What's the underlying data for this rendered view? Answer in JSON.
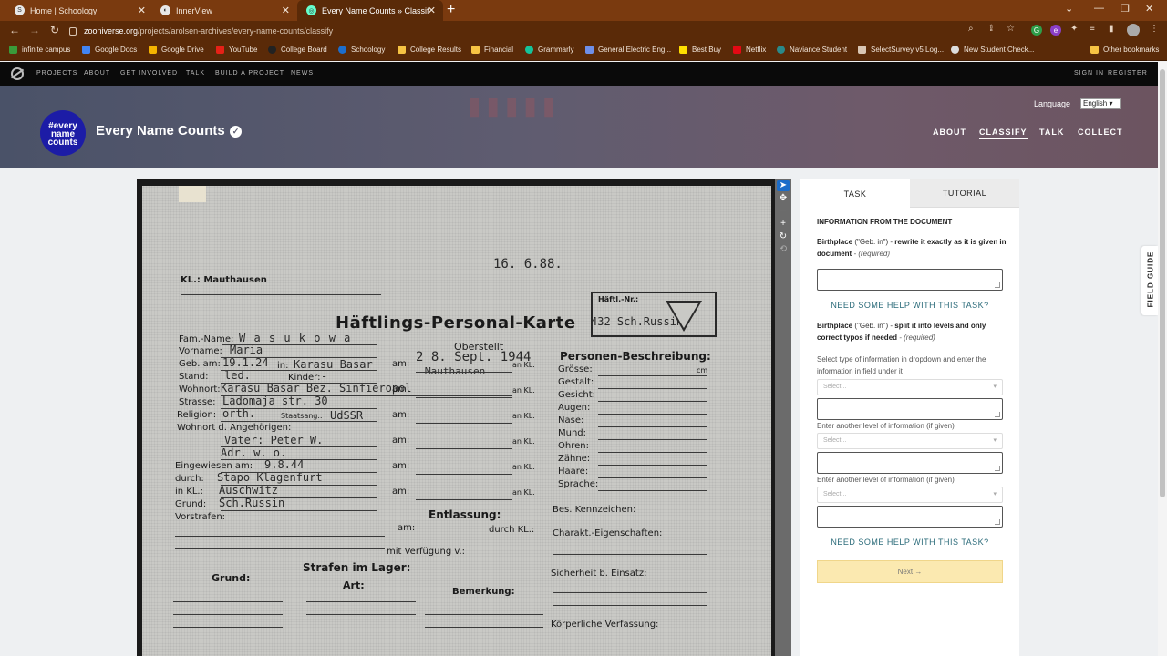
{
  "browser": {
    "tabs": [
      {
        "label": "Home | Schoology",
        "icon": "schoology-icon"
      },
      {
        "label": "InnerView",
        "icon": "innerview-icon"
      },
      {
        "label": "Every Name Counts » Classify —",
        "icon": "zooniverse-icon"
      }
    ],
    "url_host": "zooniverse.org",
    "url_path": "/projects/arolsen-archives/every-name-counts/classify",
    "bookmarks": [
      "infinite campus",
      "Google Docs",
      "Google Drive",
      "YouTube",
      "College Board",
      "Schoology",
      "College Results",
      "Financial",
      "Grammarly",
      "General Electric Eng...",
      "Best Buy",
      "Netflix",
      "Naviance Student",
      "SelectSurvey v5 Log...",
      "New Student Check..."
    ],
    "other_bookmarks": "Other bookmarks"
  },
  "site_nav": {
    "links": [
      "PROJECTS",
      "ABOUT",
      "GET INVOLVED",
      "TALK",
      "BUILD A PROJECT",
      "NEWS"
    ],
    "sign_in": "SIGN IN",
    "register": "REGISTER"
  },
  "project": {
    "logo_text": "#every name counts",
    "title": "Every Name Counts",
    "language_label": "Language",
    "language_value": "English",
    "nav": [
      "ABOUT",
      "CLASSIFY",
      "TALK",
      "COLLECT"
    ]
  },
  "document": {
    "camp": "KL.: Mauthausen",
    "date": "16. 6.88.",
    "haftl_label": "Häftl.-Nr.:",
    "haftl_value": "432 Sch.Russin",
    "heading": "Häftlings-Personal-Karte",
    "fields": [
      {
        "label": "Fam.-Name:",
        "value": "W a s u k o w a"
      },
      {
        "label": "Vorname:",
        "value": "Maria"
      },
      {
        "label": "Geb. am:",
        "value": "19.1.24"
      },
      {
        "label": "in:",
        "value": "Karasu Basar"
      },
      {
        "label": "Stand:",
        "value": "led."
      },
      {
        "label": "Kinder:",
        "value": "-"
      },
      {
        "label": "Wohnort:",
        "value": "Karasu Basar Bez. Sinfieropol"
      },
      {
        "label": "Strasse:",
        "value": "Ladomaja str. 30"
      },
      {
        "label": "Religion:",
        "value": "orth."
      },
      {
        "label": "Staatsang.:",
        "value": "UdSSR"
      },
      {
        "label": "Wohnort d. Angehörigen:",
        "value": "Vater: Peter W."
      },
      {
        "label": "",
        "value": "Adr. w. o."
      },
      {
        "label": "Eingewiesen am:",
        "value": "9.8.44"
      },
      {
        "label": "durch:",
        "value": "Stapo Klagenfurt"
      },
      {
        "label": "in KL.:",
        "value": "Auschwitz"
      },
      {
        "label": "Grund:",
        "value": "Sch.Russin"
      },
      {
        "label": "Vorstrafen:",
        "value": ""
      }
    ],
    "overstellt_date": "2 8. Sept. 1944",
    "overstellt_label": "Oberstellt",
    "overstellt_camp": "Mauthausen",
    "am_labels": [
      "am:",
      "am:",
      "am:",
      "am:",
      "am:",
      "am:",
      "am:",
      "am:"
    ],
    "an_kl": "an KL.",
    "personen": "Personen-Beschreibung:",
    "personen_fields": [
      "Grösse:",
      "Gestalt:",
      "Gesicht:",
      "Augen:",
      "Nase:",
      "Mund:",
      "Ohren:",
      "Zähne:",
      "Haare:",
      "Sprache:"
    ],
    "cm": "cm",
    "bes": "Bes. Kennzeichen:",
    "charakt": "Charakt.-Eigenschaften:",
    "entlassung": "Entlassung:",
    "durch_kl": "durch KL.:",
    "verfuegung": "mit Verfügung v.:",
    "strafen": "Strafen im Lager:",
    "grund": "Grund:",
    "art": "Art:",
    "bemerkung": "Bemerkung:",
    "sicherheit": "Sicherheit b. Einsatz:",
    "koerper": "Körperliche Verfassung:"
  },
  "viewer_tools": [
    "pointer-icon",
    "pan-icon",
    "zoom-out-icon",
    "zoom-in-icon",
    "rotate-icon",
    "reset-icon"
  ],
  "task_panel": {
    "tab_task": "TASK",
    "tab_tutorial": "TUTORIAL",
    "section_title": "INFORMATION FROM THE DOCUMENT",
    "q1_bold": "Birthplace",
    "q1_mid": " (\"Geb. in\") - ",
    "q1_rest": "rewrite it exactly as it is given in document",
    "q1_req": " - (required)",
    "help": "NEED SOME HELP WITH THIS TASK?",
    "q2_bold": "Birthplace",
    "q2_mid": " (\"Geb. in\") - ",
    "q2_rest": "split it into levels and only correct typos if needed",
    "q2_req": " - (required)",
    "select_hint": "Select type of information in dropdown and enter the information in field under it",
    "select_placeholder": "Select...",
    "another_level": "Enter another level of information (if given)",
    "next": "Next →"
  },
  "field_guide": "FIELD GUIDE"
}
